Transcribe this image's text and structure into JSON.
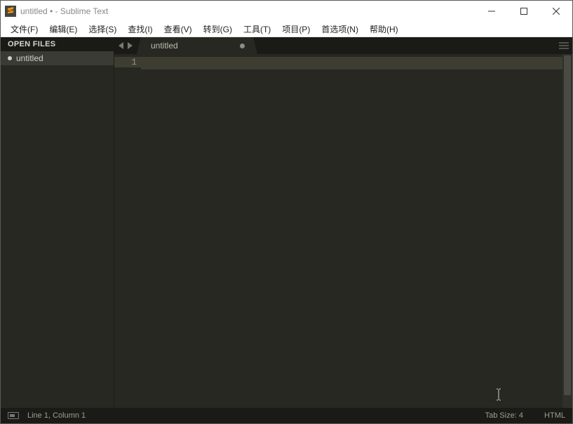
{
  "titlebar": {
    "title": "untitled • - Sublime Text"
  },
  "menubar": {
    "items": [
      "文件(F)",
      "编辑(E)",
      "选择(S)",
      "查找(I)",
      "查看(V)",
      "转到(G)",
      "工具(T)",
      "项目(P)",
      "首选项(N)",
      "帮助(H)"
    ]
  },
  "sidebar": {
    "header": "OPEN FILES",
    "files": [
      {
        "name": "untitled",
        "dirty": true
      }
    ]
  },
  "tabs": {
    "items": [
      {
        "label": "untitled",
        "dirty": true
      }
    ]
  },
  "editor": {
    "line_numbers": [
      "1"
    ]
  },
  "statusbar": {
    "position": "Line 1, Column 1",
    "tab_size": "Tab Size: 4",
    "syntax": "HTML"
  }
}
